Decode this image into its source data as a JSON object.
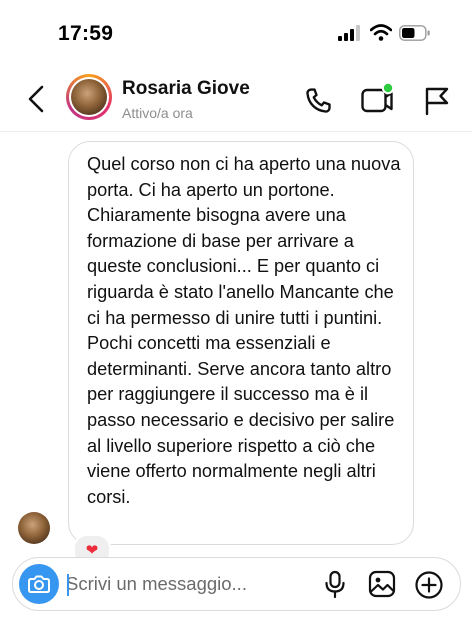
{
  "status_bar": {
    "time": "17:59"
  },
  "header": {
    "contact_name": "Rosaria Giove",
    "presence": "Attivo/a ora"
  },
  "message": {
    "text": "Quel corso non ci ha aperto una nuova porta. Ci ha aperto un portone. Chiaramente bisogna avere una formazione di base per arrivare a queste conclusioni... E per quanto ci riguarda è stato l'anello Mancante che ci ha permesso di unire tutti i puntini. Pochi concetti ma essenziali e determinanti. Serve ancora tanto altro per raggiungere il successo ma è il passo necessario e decisivo per salire al livello superiore rispetto a ciò che viene offerto normalmente negli altri corsi.",
    "reaction": "❤"
  },
  "composer": {
    "placeholder": "Scrivi un messaggio..."
  },
  "colors": {
    "accent": "#3797f0",
    "online": "#2ecc40",
    "heart": "#ed2d3b"
  },
  "icons": {
    "back": "chevron-left-icon",
    "call": "phone-icon",
    "video": "video-call-icon",
    "report": "flag-icon",
    "camera": "camera-icon",
    "mic": "microphone-icon",
    "gallery": "image-icon",
    "add": "plus-circle-icon"
  }
}
